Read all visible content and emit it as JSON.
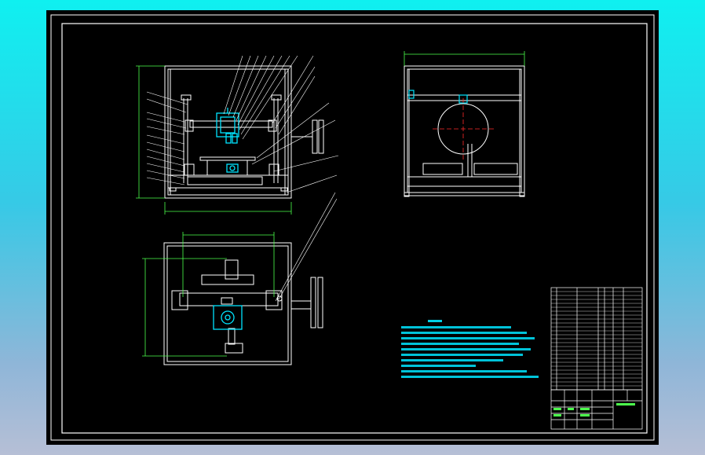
{
  "colors": {
    "background_gradient_top": "#00f0f0",
    "background_gradient_bottom": "#b6bfd6",
    "sheet": "#000000",
    "frame_line": "#ffffff",
    "part_line": "#ffffff",
    "highlight_part": "#00e5ff",
    "dimension_line": "#4cff4c",
    "center_line": "#ff2a2a",
    "note_text": "#00e5ff"
  },
  "drawing": {
    "views": [
      "front-view",
      "side-view",
      "top-view"
    ],
    "title_block": {
      "title_cell": "",
      "drawing_number": ""
    },
    "notes_title": "",
    "notes_lines": [
      "",
      "",
      "",
      "",
      "",
      "",
      "",
      ""
    ],
    "parts_list_rows": 26
  }
}
